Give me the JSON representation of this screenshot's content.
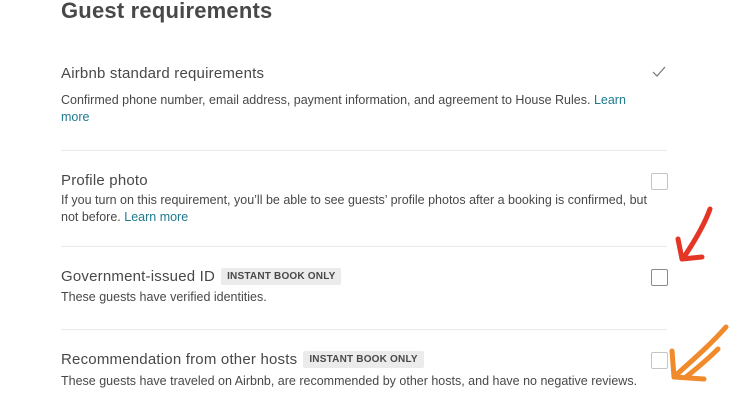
{
  "page_title": "Guest requirements",
  "requirements": [
    {
      "title": "Airbnb standard requirements",
      "description": "Confirmed phone number, email address, payment information, and agreement to House Rules.",
      "link": "Learn more",
      "checked": true
    },
    {
      "title": "Profile photo",
      "description": "If you turn on this requirement, you’ll be able to see guests’ profile photos after a booking is confirmed, but not before.",
      "link": "Learn more",
      "checked": false
    },
    {
      "title": "Government-issued ID",
      "badge": "INSTANT BOOK ONLY",
      "description": "These guests have verified identities.",
      "checked": false
    },
    {
      "title": "Recommendation from other hosts",
      "badge": "INSTANT BOOK ONLY",
      "description": "These guests have traveled on Airbnb, are recommended by other hosts, and have no negative reviews.",
      "checked": false
    }
  ],
  "annotations": {
    "red_arrow_color": "#e53524",
    "orange_arrow_color": "#f08a2b"
  }
}
